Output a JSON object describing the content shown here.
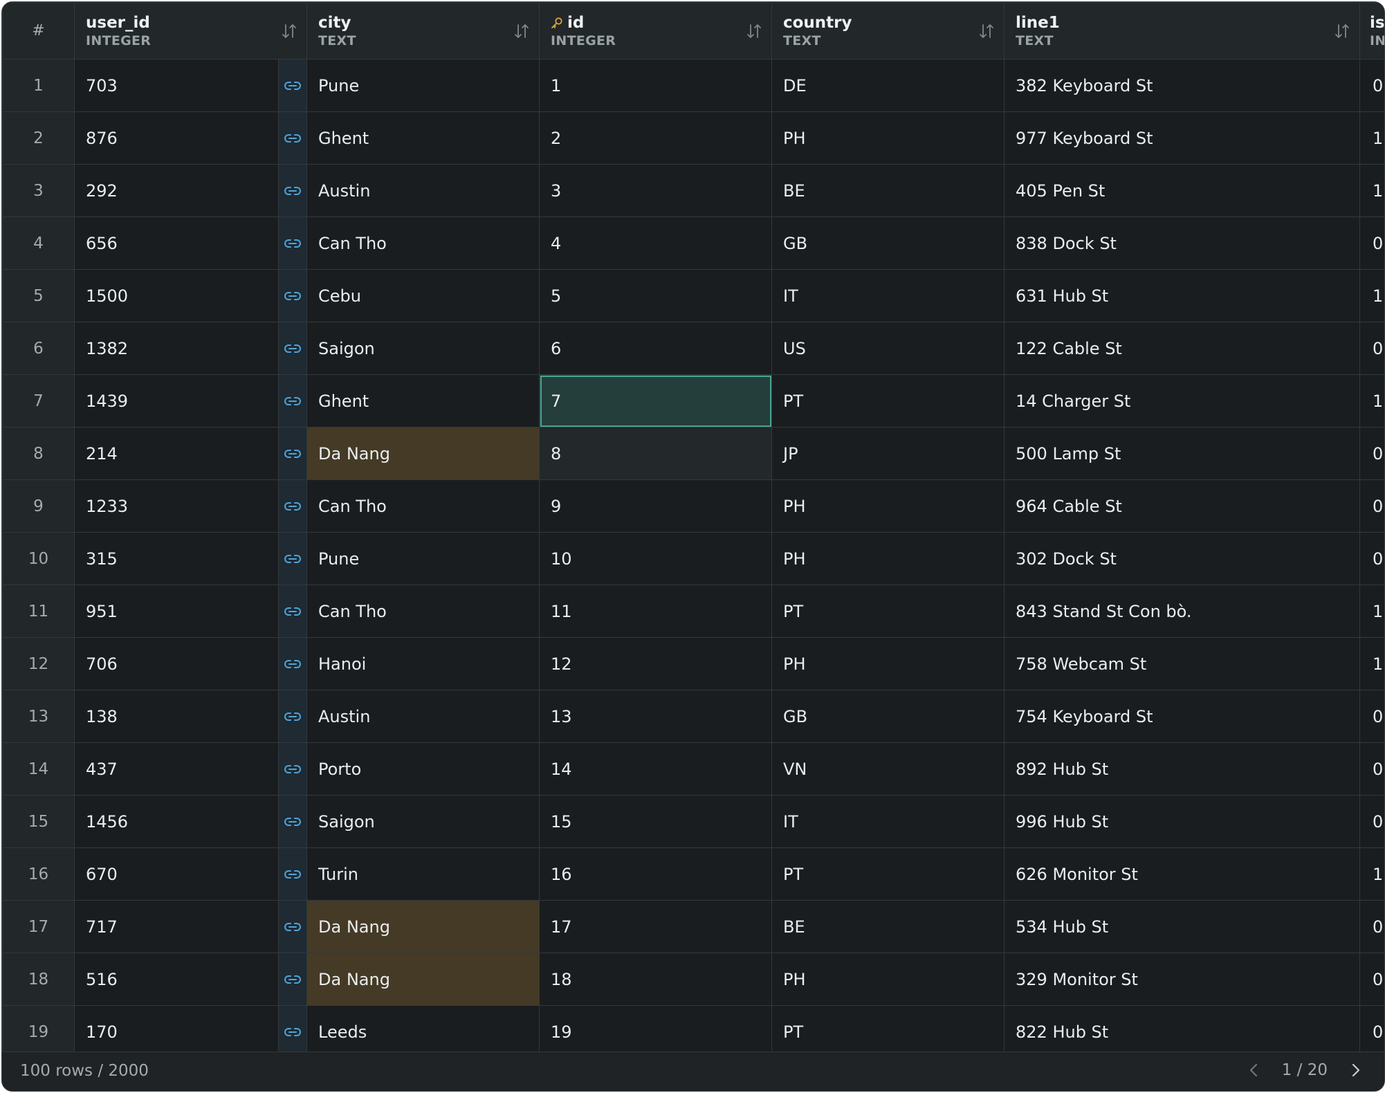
{
  "columns": [
    {
      "name": "user_id",
      "type": "INTEGER"
    },
    {
      "name": "city",
      "type": "TEXT"
    },
    {
      "name": "id",
      "type": "INTEGER"
    },
    {
      "name": "country",
      "type": "TEXT"
    },
    {
      "name": "line1",
      "type": "TEXT"
    },
    {
      "name": "is_",
      "type": "IN"
    }
  ],
  "row_number_header": "#",
  "rows": [
    {
      "n": "1",
      "user_id": "703",
      "city": "Pune",
      "id": "1",
      "country": "DE",
      "line1": "382 Keyboard St",
      "is": "0"
    },
    {
      "n": "2",
      "user_id": "876",
      "city": "Ghent",
      "id": "2",
      "country": "PH",
      "line1": "977 Keyboard St",
      "is": "1"
    },
    {
      "n": "3",
      "user_id": "292",
      "city": "Austin",
      "id": "3",
      "country": "BE",
      "line1": "405 Pen St",
      "is": "1"
    },
    {
      "n": "4",
      "user_id": "656",
      "city": "Can Tho",
      "id": "4",
      "country": "GB",
      "line1": "838 Dock St",
      "is": "0"
    },
    {
      "n": "5",
      "user_id": "1500",
      "city": "Cebu",
      "id": "5",
      "country": "IT",
      "line1": "631 Hub St",
      "is": "1"
    },
    {
      "n": "6",
      "user_id": "1382",
      "city": "Saigon",
      "id": "6",
      "country": "US",
      "line1": "122 Cable St",
      "is": "0"
    },
    {
      "n": "7",
      "user_id": "1439",
      "city": "Ghent",
      "id": "7",
      "country": "PT",
      "line1": "14 Charger St",
      "is": "1"
    },
    {
      "n": "8",
      "user_id": "214",
      "city": "Da Nang",
      "id": "8",
      "country": "JP",
      "line1": "500 Lamp St",
      "is": "0"
    },
    {
      "n": "9",
      "user_id": "1233",
      "city": "Can Tho",
      "id": "9",
      "country": "PH",
      "line1": "964 Cable St",
      "is": "0"
    },
    {
      "n": "10",
      "user_id": "315",
      "city": "Pune",
      "id": "10",
      "country": "PH",
      "line1": "302 Dock St",
      "is": "0"
    },
    {
      "n": "11",
      "user_id": "951",
      "city": "Can Tho",
      "id": "11",
      "country": "PT",
      "line1": "843 Stand St Con bò.",
      "is": "1"
    },
    {
      "n": "12",
      "user_id": "706",
      "city": "Hanoi",
      "id": "12",
      "country": "PH",
      "line1": "758 Webcam St",
      "is": "1"
    },
    {
      "n": "13",
      "user_id": "138",
      "city": "Austin",
      "id": "13",
      "country": "GB",
      "line1": "754 Keyboard St",
      "is": "0"
    },
    {
      "n": "14",
      "user_id": "437",
      "city": "Porto",
      "id": "14",
      "country": "VN",
      "line1": "892 Hub St",
      "is": "0"
    },
    {
      "n": "15",
      "user_id": "1456",
      "city": "Saigon",
      "id": "15",
      "country": "IT",
      "line1": "996 Hub St",
      "is": "0"
    },
    {
      "n": "16",
      "user_id": "670",
      "city": "Turin",
      "id": "16",
      "country": "PT",
      "line1": "626 Monitor St",
      "is": "1"
    },
    {
      "n": "17",
      "user_id": "717",
      "city": "Da Nang",
      "id": "17",
      "country": "BE",
      "line1": "534 Hub St",
      "is": "0"
    },
    {
      "n": "18",
      "user_id": "516",
      "city": "Da Nang",
      "id": "18",
      "country": "PH",
      "line1": "329 Monitor St",
      "is": "0"
    },
    {
      "n": "19",
      "user_id": "170",
      "city": "Leeds",
      "id": "19",
      "country": "PT",
      "line1": "822 Hub St",
      "is": "0"
    }
  ],
  "highlight_city": "Da Nang",
  "selected_cell": {
    "row": 7,
    "column": "id"
  },
  "footer": {
    "row_count": "100 rows / 2000",
    "page": "1 / 20"
  },
  "icons": {
    "sort": "sort-arrows-icon",
    "primary_key": "key-icon",
    "foreign_key": "link-icon",
    "prev": "chevron-left-icon",
    "next": "chevron-right-icon"
  },
  "colors": {
    "background": "#1a1d1f",
    "header": "#222729",
    "highlight": "#453a26",
    "selected": "#243f3b",
    "selected_border": "#49a393",
    "key": "#e0a53a",
    "link": "#4da6d9"
  }
}
